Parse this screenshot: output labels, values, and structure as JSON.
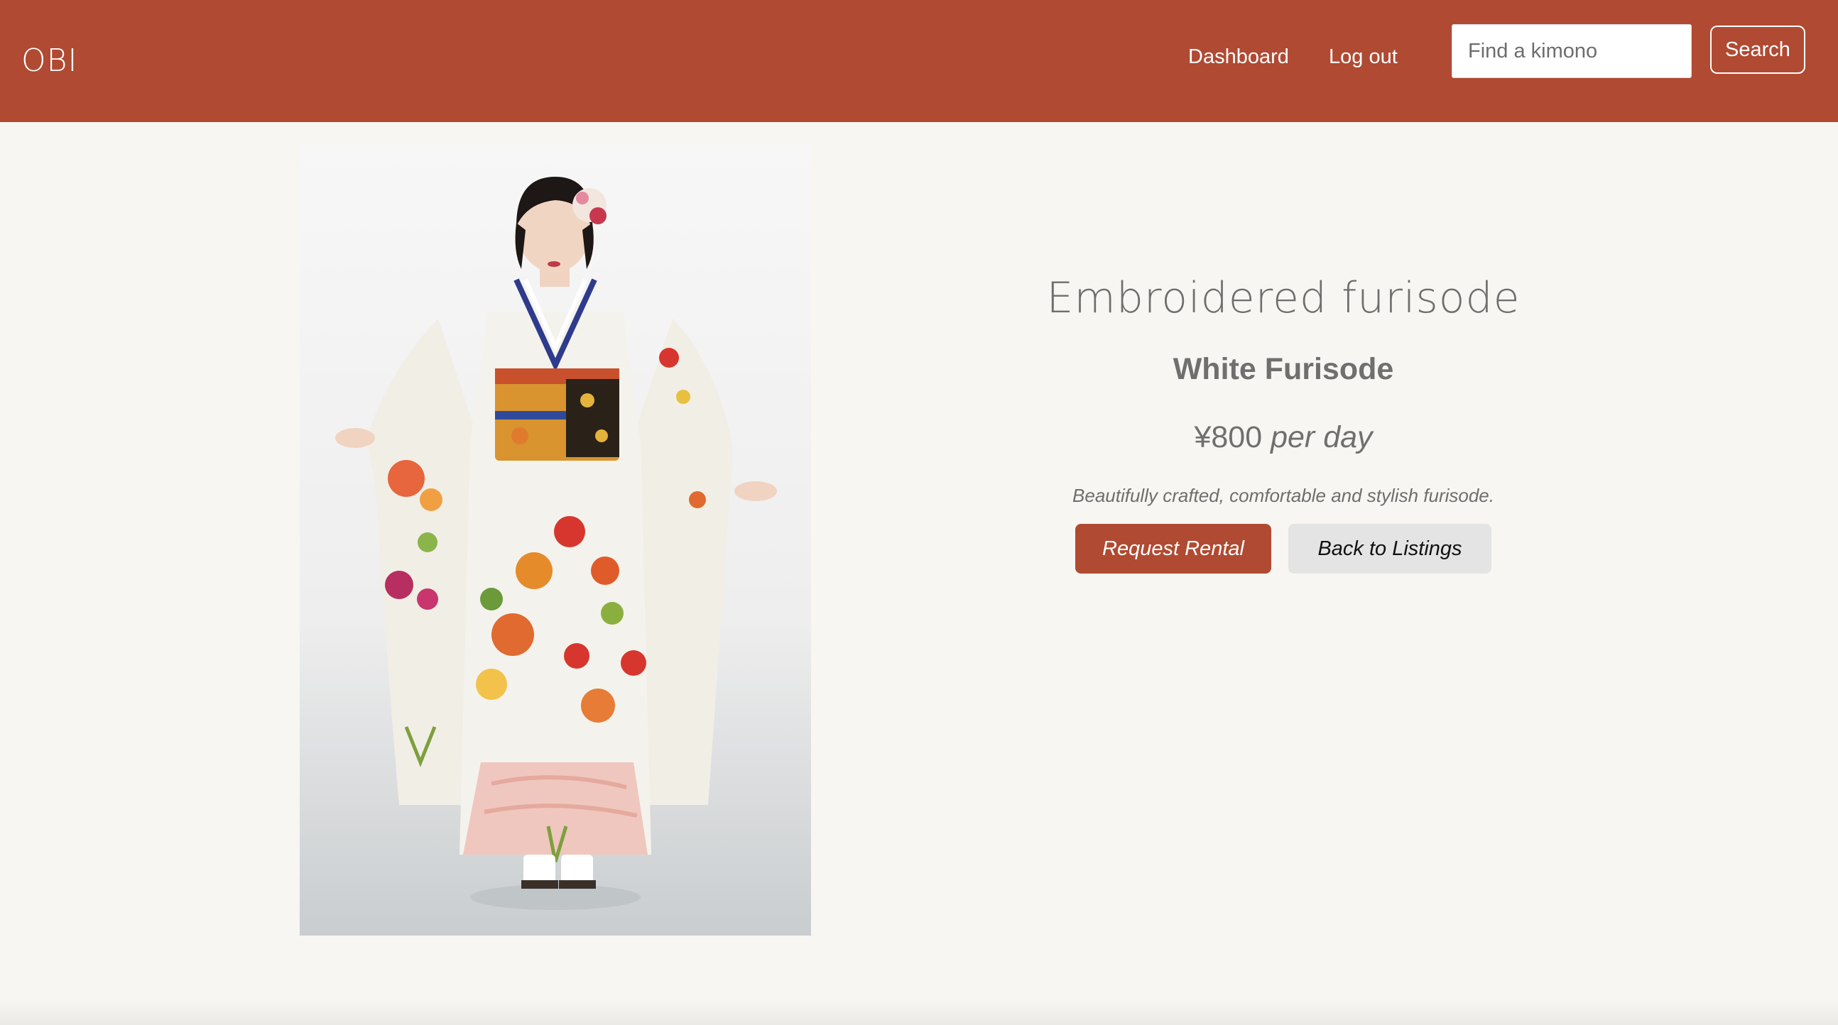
{
  "brand": {
    "logo_text": "OBI"
  },
  "nav": {
    "links": [
      "Dashboard",
      "Log out"
    ]
  },
  "search": {
    "placeholder": "Find a kimono",
    "value": "",
    "button_label": "Search"
  },
  "listing": {
    "image_subject": "woman wearing white embroidered furisode",
    "title": "Embroidered furisode",
    "name": "White Furisode",
    "price": "¥800",
    "price_unit": "per day",
    "description": "Beautifully crafted, comfortable and stylish furisode.",
    "actions": {
      "request_label": "Request Rental",
      "back_label": "Back to Listings"
    }
  },
  "colors": {
    "brand": "#b04a32",
    "background": "#f7f6f2",
    "secondary_button": "#e4e4e4"
  }
}
